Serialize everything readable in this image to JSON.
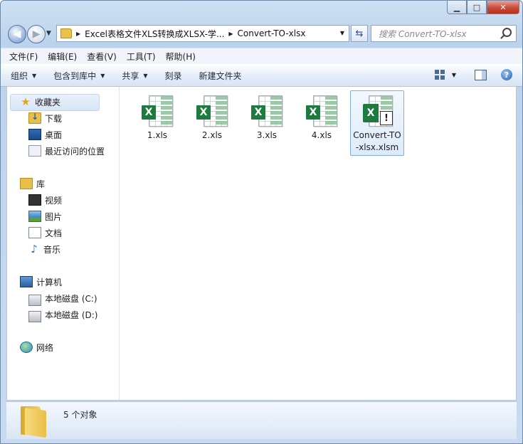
{
  "address": {
    "crumbs": [
      "Excel表格文件XLS转换成XLSX-学...",
      "Convert-TO-xlsx"
    ]
  },
  "search": {
    "placeholder": "搜索 Convert-TO-xlsx"
  },
  "menubar": {
    "items": [
      "文件(F)",
      "编辑(E)",
      "查看(V)",
      "工具(T)",
      "帮助(H)"
    ]
  },
  "toolbar": {
    "organize": "组织",
    "include_in_library": "包含到库中",
    "share": "共享",
    "burn": "刻录",
    "new_folder": "新建文件夹"
  },
  "nav": {
    "favorites": "收藏夹",
    "downloads": "下载",
    "desktop": "桌面",
    "recent": "最近访问的位置",
    "libraries": "库",
    "videos": "视频",
    "pictures": "图片",
    "documents": "文档",
    "music": "音乐",
    "computer": "计算机",
    "drive_c": "本地磁盘 (C:)",
    "drive_d": "本地磁盘 (D:)",
    "network": "网络"
  },
  "files": [
    {
      "name": "1.xls",
      "type": "xls"
    },
    {
      "name": "2.xls",
      "type": "xls"
    },
    {
      "name": "3.xls",
      "type": "xls"
    },
    {
      "name": "4.xls",
      "type": "xls"
    },
    {
      "name": "Convert-TO-xlsx.xlsm",
      "type": "xlsm",
      "selected": true
    }
  ],
  "status": {
    "count_text": "5 个对象"
  },
  "colors": {
    "excel_green": "#1e7b3f",
    "selection_border": "#84acdd"
  }
}
